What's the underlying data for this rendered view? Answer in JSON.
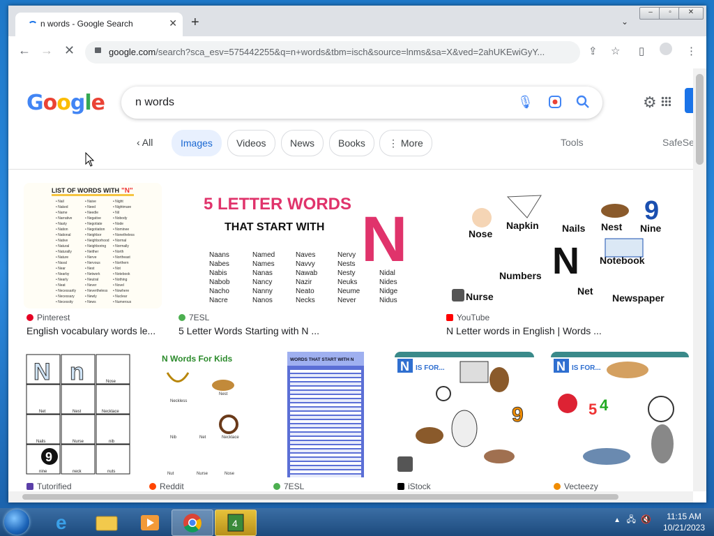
{
  "browser": {
    "tab_title": "n words - Google Search",
    "tab_close": "✕",
    "new_tab": "+",
    "url_main": "google.com",
    "url_rest": "/search?sca_esv=575442255&q=n+words&tbm=isch&source=lnms&sa=X&ved=2ahUKEwiGyY..."
  },
  "search": {
    "query": "n words",
    "logo": [
      "G",
      "o",
      "o",
      "g",
      "l",
      "e"
    ],
    "logo_colors": [
      "#4285F4",
      "#EA4335",
      "#FBBC05",
      "#4285F4",
      "#34A853",
      "#EA4335"
    ]
  },
  "filters": {
    "back_label": "All",
    "items": [
      "Images",
      "Videos",
      "News",
      "Books",
      "More"
    ],
    "tools": "Tools",
    "safesearch": "SafeSe"
  },
  "results": [
    {
      "source": "Pinterest",
      "caption": "English vocabulary words le...",
      "fav_color": "#e60023"
    },
    {
      "source": "7ESL",
      "caption": "5 Letter Words Starting with N ...",
      "fav_color": "#4caf50"
    },
    {
      "source": "YouTube",
      "caption": "N Letter words in English | Words ...",
      "fav_color": "#ff0000"
    },
    {
      "source": "Tutorified",
      "caption": "",
      "fav_color": "#5b3fa8"
    },
    {
      "source": "Reddit",
      "caption": "",
      "fav_color": "#ff4500"
    },
    {
      "source": "7ESL",
      "caption": "",
      "fav_color": "#4caf50"
    },
    {
      "source": "iStock",
      "caption": "",
      "fav_color": "#000000"
    },
    {
      "source": "Vecteezy",
      "caption": "",
      "fav_color": "#f08c00"
    }
  ],
  "thumbs": {
    "list_title": "LIST OF WORDS WITH",
    "list_letter": "\"N\"",
    "list_col1": [
      "Nail",
      "Naked",
      "Name",
      "Narrative",
      "Nasty",
      "Nation",
      "National",
      "Native",
      "Natural",
      "Naturally",
      "Nature",
      "Naval",
      "Near",
      "Nearby",
      "Nearly",
      "Neat",
      "Necessarily",
      "Necessary",
      "Necessity"
    ],
    "list_col2": [
      "Naive",
      "Need",
      "Needle",
      "Negative",
      "Negotiate",
      "Negotiation",
      "Neighbor",
      "Neighborhood",
      "Neighboring",
      "Neither",
      "Nerve",
      "Nervous",
      "Nest",
      "Network",
      "Neutral",
      "Never",
      "Nevertheless",
      "Newly",
      "News"
    ],
    "list_col3": [
      "Night",
      "Nightmare",
      "Nil",
      "Nobody",
      "Node",
      "Nominee",
      "Nonetheless",
      "Normal",
      "Normally",
      "North",
      "Northeast",
      "Northern",
      "Not",
      "Notebook",
      "Nothing",
      "Novel",
      "Nowhere",
      "Nuclear",
      "Numerous"
    ],
    "fl_title": "5 LETTER WORDS",
    "fl_sub": "THAT START WITH",
    "fl_letter": "N",
    "fl_col1": [
      "Naans",
      "Nabes",
      "Nabis",
      "Nabob",
      "Nacho",
      "Nacre"
    ],
    "fl_col2": [
      "Named",
      "Names",
      "Nanas",
      "Nancy",
      "Nanny",
      "Nanos"
    ],
    "fl_col3": [
      "Naves",
      "Navvy",
      "Nawab",
      "Nazir",
      "Neato",
      "Necks"
    ],
    "fl_col4": [
      "Nervy",
      "Nests",
      "Nesty",
      "Neuks",
      "Neume",
      "Never"
    ],
    "fl_col5": [
      "Nidal",
      "Nides",
      "Nidge",
      "Nidus"
    ],
    "yt_words": [
      "Nose",
      "Napkin",
      "Nails",
      "Nest",
      "Nine",
      "Numbers",
      "Notebook",
      "Nurse",
      "Net",
      "Newspaper"
    ],
    "yt_letter": "N",
    "yt_nine": "9",
    "tut_labels": [
      "Net",
      "Nest",
      "Necklace",
      "Nails",
      "Nurse",
      "nib",
      "nine",
      "neck",
      "nuts",
      "Nose"
    ],
    "kids_title": "N Words For Kids",
    "kids_labels": [
      "Neckless",
      "Nest",
      "Nib",
      "Net",
      "Necklace",
      "Nut",
      "Nurse",
      "Nose"
    ],
    "wts_title": "WORDS THAT START WITH N",
    "isfor": "IS FOR..."
  },
  "taskbar": {
    "time": "11:15 AM",
    "date": "10/21/2023"
  }
}
